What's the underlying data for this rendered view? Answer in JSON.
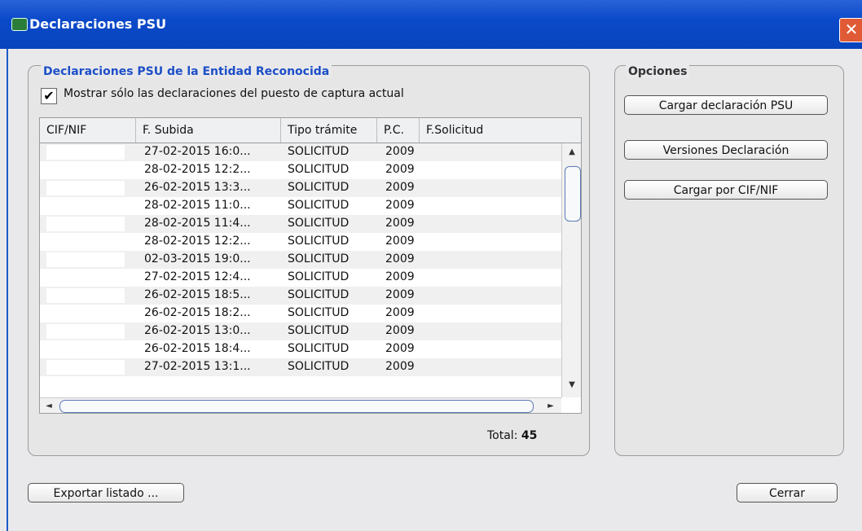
{
  "window": {
    "title": "Declaraciones PSU",
    "close_symbol": "✕"
  },
  "main_panel": {
    "title": "Declaraciones PSU de la Entidad Reconocida",
    "filter_checkbox": {
      "checked": true,
      "check_symbol": "✔",
      "label": "Mostrar sólo las declaraciones del puesto de captura actual"
    }
  },
  "table": {
    "columns": [
      "CIF/NIF",
      "F. Subida",
      "Tipo trámite",
      "P.C.",
      "F.Solicitud"
    ],
    "rows": [
      {
        "cif": "",
        "subida": "27-02-2015 16:0...",
        "tipo": "SOLICITUD",
        "pc": "2009",
        "solicitud": ""
      },
      {
        "cif": "",
        "subida": "28-02-2015 12:2...",
        "tipo": "SOLICITUD",
        "pc": "2009",
        "solicitud": ""
      },
      {
        "cif": "",
        "subida": "26-02-2015 13:3...",
        "tipo": "SOLICITUD",
        "pc": "2009",
        "solicitud": ""
      },
      {
        "cif": "",
        "subida": "28-02-2015 11:0...",
        "tipo": "SOLICITUD",
        "pc": "2009",
        "solicitud": ""
      },
      {
        "cif": "",
        "subida": "28-02-2015 11:4...",
        "tipo": "SOLICITUD",
        "pc": "2009",
        "solicitud": ""
      },
      {
        "cif": "",
        "subida": "28-02-2015 12:2...",
        "tipo": "SOLICITUD",
        "pc": "2009",
        "solicitud": ""
      },
      {
        "cif": "",
        "subida": "02-03-2015 19:0...",
        "tipo": "SOLICITUD",
        "pc": "2009",
        "solicitud": ""
      },
      {
        "cif": "",
        "subida": "27-02-2015 12:4...",
        "tipo": "SOLICITUD",
        "pc": "2009",
        "solicitud": ""
      },
      {
        "cif": "",
        "subida": "26-02-2015 18:5...",
        "tipo": "SOLICITUD",
        "pc": "2009",
        "solicitud": ""
      },
      {
        "cif": "",
        "subida": "26-02-2015 18:2...",
        "tipo": "SOLICITUD",
        "pc": "2009",
        "solicitud": ""
      },
      {
        "cif": "",
        "subida": "26-02-2015 13:0...",
        "tipo": "SOLICITUD",
        "pc": "2009",
        "solicitud": ""
      },
      {
        "cif": "",
        "subida": "26-02-2015 18:4...",
        "tipo": "SOLICITUD",
        "pc": "2009",
        "solicitud": ""
      },
      {
        "cif": "",
        "subida": "27-02-2015 13:1...",
        "tipo": "SOLICITUD",
        "pc": "2009",
        "solicitud": ""
      }
    ],
    "scroll_symbols": {
      "up": "▲",
      "down": "▼",
      "left": "◄",
      "right": "►"
    }
  },
  "total": {
    "label": "Total:",
    "value": "45"
  },
  "options_panel": {
    "title": "Opciones",
    "buttons": [
      "Cargar declaración PSU",
      "Versiones Declaración",
      "Cargar por CIF/NIF"
    ]
  },
  "footer": {
    "export_label": "Exportar listado ...",
    "close_label": "Cerrar"
  }
}
